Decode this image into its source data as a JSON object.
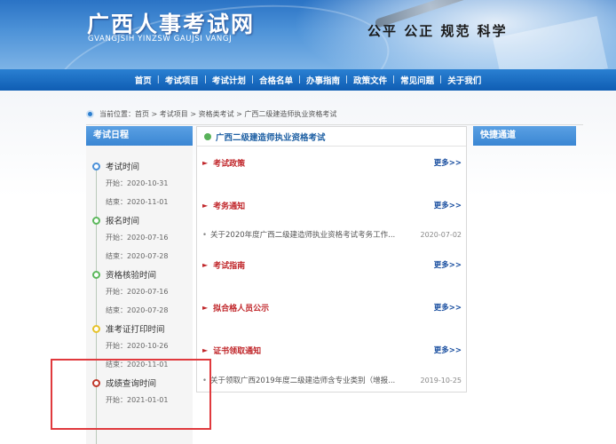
{
  "header": {
    "title": "广西人事考试网",
    "subtitle": "GVANGJSIH YINZSW GAUJSI VANGJ",
    "slogan": "公平 公正 规范 科学"
  },
  "nav": {
    "items": [
      "首页",
      "考试项目",
      "考试计划",
      "合格名单",
      "办事指南",
      "政策文件",
      "常见问题",
      "关于我们"
    ],
    "separator": "|"
  },
  "breadcrumb": {
    "text": "当前位置：首页 > 考试项目 > 资格类考试 > 广西二级建造师执业资格考试"
  },
  "schedule": {
    "heading": "考试日程",
    "items": [
      {
        "title": "考试时间",
        "start": "开始：2020-10-31",
        "end": "结束：2020-11-01",
        "color": "#4a90d9"
      },
      {
        "title": "报名时间",
        "start": "开始：2020-07-16",
        "end": "结束：2020-07-28",
        "color": "#5cb85c"
      },
      {
        "title": "资格核验时间",
        "start": "开始：2020-07-16",
        "end": "结束：2020-07-28",
        "color": "#5cb85c"
      },
      {
        "title": "准考证打印时间",
        "start": "开始：2020-10-26",
        "end": "结束：2020-11-01",
        "color": "#e6c229"
      },
      {
        "title": "成绩查询时间",
        "start": "开始：2021-01-01",
        "end": "",
        "color": "#c0392b"
      }
    ]
  },
  "main": {
    "heading": "广西二级建造师执业资格考试",
    "more_label": "更多>>",
    "sections": [
      {
        "title": "考试政策",
        "news": []
      },
      {
        "title": "考务通知",
        "news": [
          {
            "text": "关于2020年度广西二级建造师执业资格考试考务工作...",
            "date": "2020-07-02"
          }
        ]
      },
      {
        "title": "考试指南",
        "news": []
      },
      {
        "title": "拟合格人员公示",
        "news": []
      },
      {
        "title": "证书领取通知",
        "news": [
          {
            "text": "关于领取广西2019年度二级建造师含专业类别（增报...",
            "date": "2019-10-25"
          }
        ]
      }
    ]
  },
  "quick": {
    "heading": "快捷通道"
  },
  "colors": {
    "nav_blue": "#0f5db3",
    "section_red": "#c0262a",
    "more_blue": "#1a4fa0",
    "highlight_red": "#e0393d"
  }
}
